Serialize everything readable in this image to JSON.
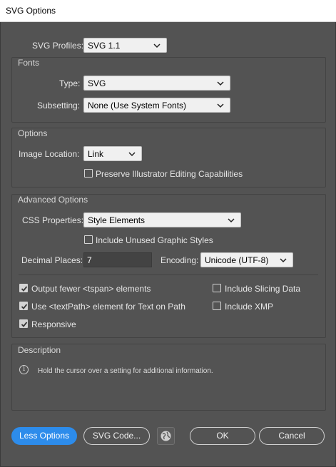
{
  "window": {
    "title": "SVG Options"
  },
  "profiles": {
    "label": "SVG Profiles:",
    "value": "SVG 1.1"
  },
  "fonts": {
    "group_title": "Fonts",
    "type_label": "Type:",
    "type_value": "SVG",
    "subsetting_label": "Subsetting:",
    "subsetting_value": "None (Use System Fonts)"
  },
  "options": {
    "group_title": "Options",
    "image_location_label": "Image Location:",
    "image_location_value": "Link",
    "preserve_label": "Preserve Illustrator Editing Capabilities",
    "preserve_checked": false
  },
  "advanced": {
    "group_title": "Advanced Options",
    "css_label": "CSS Properties:",
    "css_value": "Style Elements",
    "unused_styles_label": "Include Unused Graphic Styles",
    "unused_styles_checked": false,
    "decimal_label": "Decimal Places:",
    "decimal_value": "7",
    "encoding_label": "Encoding:",
    "encoding_value": "Unicode (UTF-8)",
    "fewer_tspan_label": "Output fewer <tspan> elements",
    "fewer_tspan_checked": true,
    "textpath_label": "Use <textPath> element for Text on Path",
    "textpath_checked": true,
    "responsive_label": "Responsive",
    "responsive_checked": true,
    "slicing_label": "Include Slicing Data",
    "slicing_checked": false,
    "xmp_label": "Include XMP",
    "xmp_checked": false
  },
  "description": {
    "group_title": "Description",
    "text": "Hold the cursor over a setting for additional information."
  },
  "buttons": {
    "less_options": "Less Options",
    "svg_code": "SVG Code...",
    "ok": "OK",
    "cancel": "Cancel"
  },
  "icons": {
    "dropdown": "chevron-down-icon",
    "browser": "globe-icon",
    "info": "info-icon",
    "check": "checkmark-icon"
  },
  "colors": {
    "dialog_bg": "#535353",
    "accent": "#2d8ceb",
    "field_bg": "#f0f0f0"
  }
}
